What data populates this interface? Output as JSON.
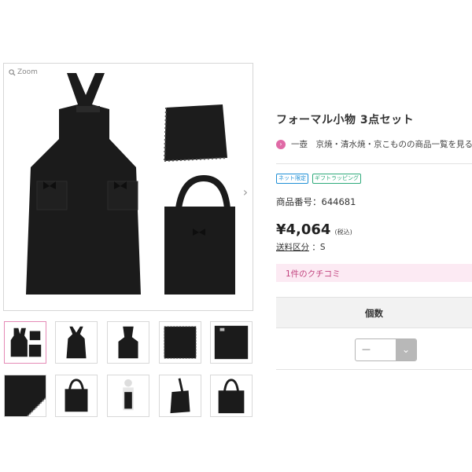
{
  "gallery": {
    "zoom_label": "Zoom",
    "next_arrow": "›",
    "thumbnails": [
      "set-all",
      "apron-front",
      "apron-back",
      "cloth",
      "cloth-folded",
      "cloth-corner",
      "tote-bag",
      "apron-worn",
      "tote-side",
      "tote-front"
    ]
  },
  "product": {
    "title": "フォーマル小物 3点セット",
    "shop_link": "一壺　京焼・清水焼・京こものの商品一覧を見る",
    "badges": {
      "net": "ネット限定",
      "gift": "ギフトラッピング"
    },
    "product_no_label": "商品番号：644681",
    "price": "¥4,064",
    "tax": "(税込)",
    "shipping_link": "送料区分",
    "shipping_value": "：S"
  },
  "reviews": {
    "link": "1件のクチコミ"
  },
  "quantity": {
    "label": "個数",
    "selected": "—",
    "chevron": "⌄"
  },
  "colors": {
    "accent_pink": "#e06aa6",
    "review_bg": "#fceaf3",
    "net_badge": "#1e8fd6",
    "gift_badge": "#2eaa7a"
  },
  "icons": {
    "zoom": "magnifier-icon",
    "shop": "circle-arrow-icon",
    "next": "chevron-right-icon",
    "select": "chevron-down-icon"
  }
}
